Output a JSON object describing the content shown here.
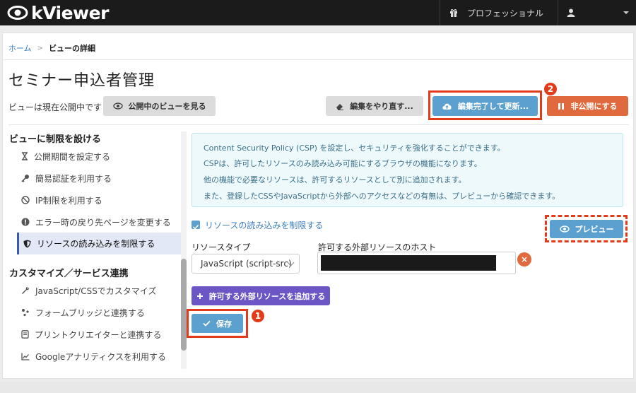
{
  "app": {
    "logo_text": "kViewer"
  },
  "nav": {
    "plan_label": "プロフェッショナル"
  },
  "breadcrumb": {
    "home": "ホーム",
    "sep": ">",
    "current": "ビューの詳細"
  },
  "page": {
    "title": "セミナー申込者管理",
    "status_text": "ビューは現在公開中です"
  },
  "actions": {
    "view_public": "公開中のビューを見る",
    "redo_edit": "編集をやり直す...",
    "finish_update": "編集完了して更新...",
    "unpublish": "非公開にする"
  },
  "annotations": {
    "badge_1": "1",
    "badge_2": "2"
  },
  "sidebar": {
    "section1": "ビューに制限を設ける",
    "items1": [
      {
        "label": "公開期間を設定する",
        "icon": "hourglass-icon"
      },
      {
        "label": "簡易認証を利用する",
        "icon": "key-icon"
      },
      {
        "label": "IP制限を利用する",
        "icon": "ban-icon"
      },
      {
        "label": "エラー時の戻り先ページを変更する",
        "icon": "exclamation-icon"
      },
      {
        "label": "リソースの読み込みを制限する",
        "icon": "shield-icon",
        "active": true
      }
    ],
    "section2": "カスタマイズ／サービス連携",
    "items2": [
      {
        "label": "JavaScript/CSSでカスタマイズ",
        "icon": "wrench-icon"
      },
      {
        "label": "フォームブリッジと連携する",
        "icon": "bridge-icon"
      },
      {
        "label": "プリントクリエイターと連携する",
        "icon": "print-icon"
      },
      {
        "label": "Googleアナリティクスを利用する",
        "icon": "chart-icon"
      }
    ]
  },
  "csp": {
    "info_lines": [
      "Content Security Policy (CSP) を設定し、セキュリティを強化することができます。",
      "CSPは、許可したリソースのみ読み込み可能にするブラウザの機能になります。",
      "他の機能で必要なリソースは、許可するリソースとして別に追加されます。",
      "また、登録したCSSやJavaScriptから外部へのアクセスなどの有無は、プレビューから確認できます。"
    ],
    "restrict_checkbox_label": "リソースの読み込みを制限する",
    "restrict_checked": true,
    "preview_button": "プレビュー",
    "resource_type_label": "リソースタイプ",
    "resource_type_value": "JavaScript (script-src)",
    "host_label": "許可する外部リソースのホスト",
    "remove_symbol": "×",
    "add_button": "許可する外部リソースを追加する",
    "save_button": "保存"
  },
  "colors": {
    "nav_bg": "#1b1b1b",
    "primary_blue": "#5ba0cf",
    "orange": "#e06a3e",
    "purple": "#6c55c4",
    "annotation_red": "#e23b1b"
  }
}
